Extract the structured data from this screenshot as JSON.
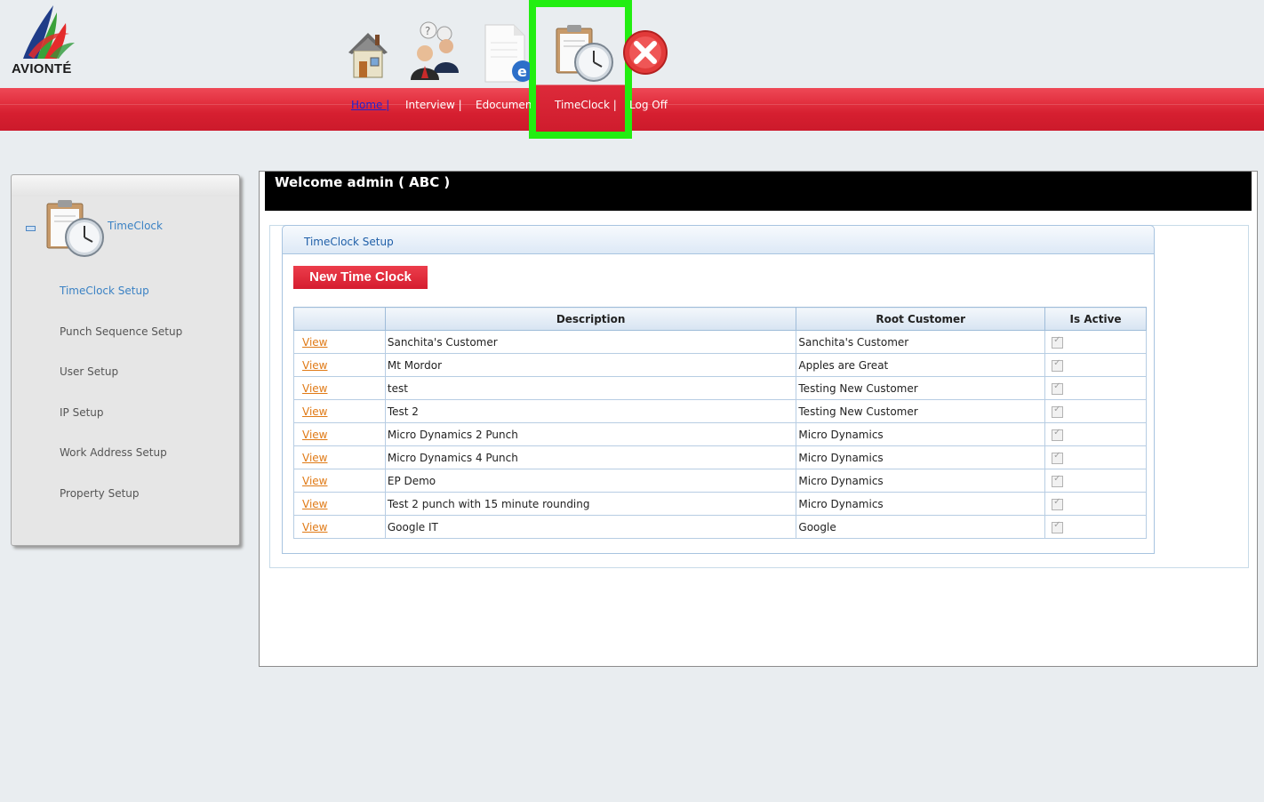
{
  "brand": {
    "logo_text": "AVIONTÉ"
  },
  "nav": {
    "items": [
      {
        "label": "Home |",
        "icon": "house-icon"
      },
      {
        "label": "Interview |",
        "icon": "interview-people-icon"
      },
      {
        "label": "Edocument",
        "icon": "edocument-icon"
      },
      {
        "label": "TimeClock |",
        "icon": "timeclock-icon"
      },
      {
        "label": "Log Off",
        "icon": "logoff-icon"
      }
    ]
  },
  "sidebar": {
    "title": "TimeClock",
    "items": [
      {
        "label": "TimeClock Setup",
        "active": true
      },
      {
        "label": "Punch Sequence Setup"
      },
      {
        "label": "User Setup"
      },
      {
        "label": "IP Setup"
      },
      {
        "label": "Work Address Setup"
      },
      {
        "label": "Property Setup"
      }
    ]
  },
  "main": {
    "welcome": "Welcome admin ( ABC )",
    "panel_title": "TimeClock Setup",
    "new_button": "New Time Clock",
    "table": {
      "headers": [
        "",
        "Description",
        "Root Customer",
        "Is Active"
      ],
      "rows": [
        {
          "link": "View",
          "description": "Sanchita's Customer",
          "root_customer": "Sanchita's Customer",
          "is_active": true
        },
        {
          "link": "View",
          "description": "Mt Mordor",
          "root_customer": "Apples are Great",
          "is_active": true
        },
        {
          "link": "View",
          "description": "test",
          "root_customer": "Testing New Customer",
          "is_active": true
        },
        {
          "link": "View",
          "description": "Test 2",
          "root_customer": "Testing New Customer",
          "is_active": true
        },
        {
          "link": "View",
          "description": "Micro Dynamics 2 Punch",
          "root_customer": "Micro Dynamics",
          "is_active": true
        },
        {
          "link": "View",
          "description": "Micro Dynamics 4 Punch",
          "root_customer": "Micro Dynamics",
          "is_active": true
        },
        {
          "link": "View",
          "description": "EP Demo",
          "root_customer": "Micro Dynamics",
          "is_active": true
        },
        {
          "link": "View",
          "description": "Test 2 punch with 15 minute rounding",
          "root_customer": "Micro Dynamics",
          "is_active": true
        },
        {
          "link": "View",
          "description": "Google IT",
          "root_customer": "Google",
          "is_active": true
        }
      ]
    }
  },
  "colors": {
    "brand_red": "#d61f30",
    "highlight_green": "#22ee11",
    "link_orange": "#e07a16",
    "accent_blue": "#3b82c4"
  }
}
